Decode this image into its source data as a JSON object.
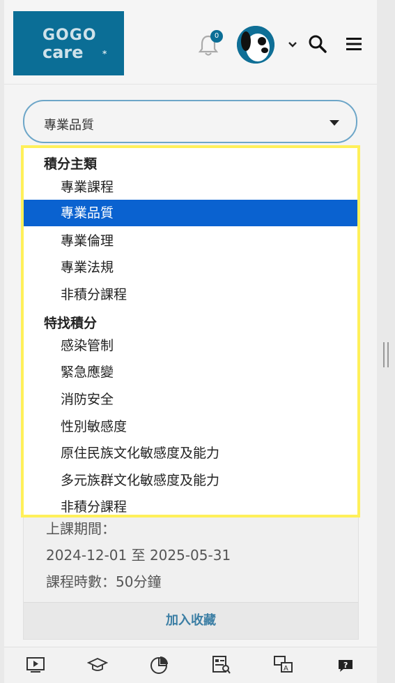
{
  "header": {
    "logo_line1": "GOGO",
    "logo_line2": "care",
    "logo_mark": "*",
    "notification_count": "0"
  },
  "select": {
    "value": "專業品質"
  },
  "dropdown": {
    "groups": [
      {
        "label": "積分主類",
        "options": [
          "專業課程",
          "專業品質",
          "專業倫理",
          "專業法規",
          "非積分課程"
        ]
      },
      {
        "label": "特找積分",
        "options": [
          "感染管制",
          "緊急應變",
          "消防安全",
          "性別敏感度",
          "原住民族文化敏感度及能力",
          "多元族群文化敏感度及能力",
          "非積分課程"
        ]
      }
    ],
    "selected": "專業品質"
  },
  "card": {
    "period_label": "上課期間：",
    "period_value": "2024-12-01 至 2025-05-31",
    "hours": "課程時數：50分鐘",
    "favorite_button": "加入收藏"
  },
  "bottom_nav": [
    "video-icon",
    "graduation-cap-icon",
    "pie-chart-icon",
    "document-search-icon",
    "translate-icon",
    "help-chat-icon"
  ]
}
